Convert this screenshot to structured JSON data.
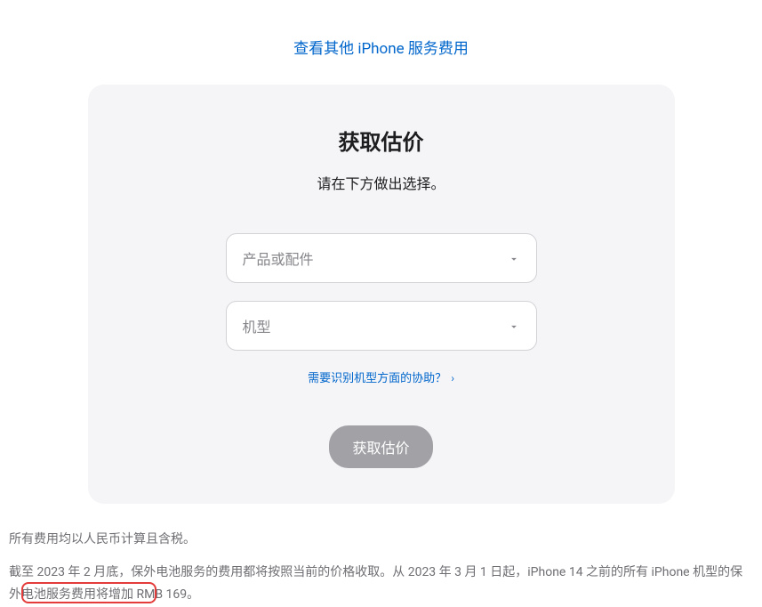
{
  "topLink": "查看其他 iPhone 服务费用",
  "card": {
    "title": "获取估价",
    "subtitle": "请在下方做出选择。",
    "productSelect": {
      "placeholder": "产品或配件"
    },
    "modelSelect": {
      "placeholder": "机型"
    },
    "helpLink": "需要识别机型方面的协助？",
    "submitButton": "获取估价"
  },
  "footer": {
    "line1": "所有费用均以人民币计算且含税。",
    "line2": "截至 2023 年 2 月底，保外电池服务的费用都将按照当前的价格收取。从 2023 年 3 月 1 日起，iPhone 14 之前的所有 iPhone 机型的保外电池服务费用将增加 RMB 169。"
  }
}
